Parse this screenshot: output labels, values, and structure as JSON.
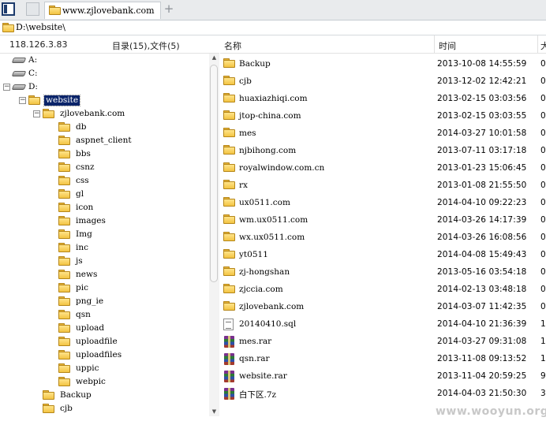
{
  "tab": {
    "title": "www.zjlovebank.com",
    "add": "+"
  },
  "address": {
    "path": "D:\\website\\"
  },
  "left": {
    "ip": "118.126.3.83",
    "counts": "目录(15),文件(5)"
  },
  "tree": [
    {
      "label": "A:",
      "type": "drive",
      "depth": 0,
      "expander": ""
    },
    {
      "label": "C:",
      "type": "drive",
      "depth": 0,
      "expander": ""
    },
    {
      "label": "D:",
      "type": "drive",
      "depth": 0,
      "expander": "−"
    },
    {
      "label": "website",
      "type": "folder",
      "depth": 1,
      "expander": "−",
      "selected": true
    },
    {
      "label": "zjlovebank.com",
      "type": "folder",
      "depth": 2,
      "expander": "−"
    },
    {
      "label": "db",
      "type": "folder",
      "depth": 3,
      "expander": ""
    },
    {
      "label": "aspnet_client",
      "type": "folder",
      "depth": 3,
      "expander": ""
    },
    {
      "label": "bbs",
      "type": "folder",
      "depth": 3,
      "expander": ""
    },
    {
      "label": "csnz",
      "type": "folder",
      "depth": 3,
      "expander": ""
    },
    {
      "label": "css",
      "type": "folder",
      "depth": 3,
      "expander": ""
    },
    {
      "label": "gl",
      "type": "folder",
      "depth": 3,
      "expander": ""
    },
    {
      "label": "icon",
      "type": "folder",
      "depth": 3,
      "expander": ""
    },
    {
      "label": "images",
      "type": "folder",
      "depth": 3,
      "expander": ""
    },
    {
      "label": "Img",
      "type": "folder",
      "depth": 3,
      "expander": ""
    },
    {
      "label": "inc",
      "type": "folder",
      "depth": 3,
      "expander": ""
    },
    {
      "label": "js",
      "type": "folder",
      "depth": 3,
      "expander": ""
    },
    {
      "label": "news",
      "type": "folder",
      "depth": 3,
      "expander": ""
    },
    {
      "label": "pic",
      "type": "folder",
      "depth": 3,
      "expander": ""
    },
    {
      "label": "png_ie",
      "type": "folder",
      "depth": 3,
      "expander": ""
    },
    {
      "label": "qsn",
      "type": "folder",
      "depth": 3,
      "expander": ""
    },
    {
      "label": "upload",
      "type": "folder",
      "depth": 3,
      "expander": ""
    },
    {
      "label": "uploadfile",
      "type": "folder",
      "depth": 3,
      "expander": ""
    },
    {
      "label": "uploadfiles",
      "type": "folder",
      "depth": 3,
      "expander": ""
    },
    {
      "label": "uppic",
      "type": "folder",
      "depth": 3,
      "expander": ""
    },
    {
      "label": "webpic",
      "type": "folder",
      "depth": 3,
      "expander": ""
    },
    {
      "label": "Backup",
      "type": "folder",
      "depth": 2,
      "expander": ""
    },
    {
      "label": "cjb",
      "type": "folder",
      "depth": 2,
      "expander": ""
    }
  ],
  "columns": {
    "name": "名称",
    "time": "时间",
    "size": "大"
  },
  "files": [
    {
      "name": "Backup",
      "time": "2013-10-08 14:55:59",
      "size": "0",
      "type": "folder"
    },
    {
      "name": "cjb",
      "time": "2013-12-02 12:42:21",
      "size": "0",
      "type": "folder"
    },
    {
      "name": "huaxiazhiqi.com",
      "time": "2013-02-15 03:03:56",
      "size": "0",
      "type": "folder"
    },
    {
      "name": "jtop-china.com",
      "time": "2013-02-15 03:03:55",
      "size": "0",
      "type": "folder"
    },
    {
      "name": "mes",
      "time": "2014-03-27 10:01:58",
      "size": "0",
      "type": "folder"
    },
    {
      "name": "njbihong.com",
      "time": "2013-07-11 03:17:18",
      "size": "0",
      "type": "folder"
    },
    {
      "name": "royalwindow.com.cn",
      "time": "2013-01-23 15:06:45",
      "size": "0",
      "type": "folder"
    },
    {
      "name": "rx",
      "time": "2013-01-08 21:55:50",
      "size": "0",
      "type": "folder"
    },
    {
      "name": "ux0511.com",
      "time": "2014-04-10 09:22:23",
      "size": "0",
      "type": "folder"
    },
    {
      "name": "wm.ux0511.com",
      "time": "2014-03-26 14:17:39",
      "size": "0",
      "type": "folder"
    },
    {
      "name": "wx.ux0511.com",
      "time": "2014-03-26 16:08:56",
      "size": "0",
      "type": "folder"
    },
    {
      "name": "yt0511",
      "time": "2014-04-08 15:49:43",
      "size": "0",
      "type": "folder"
    },
    {
      "name": "zj-hongshan",
      "time": "2013-05-16 03:54:18",
      "size": "0",
      "type": "folder"
    },
    {
      "name": "zjccia.com",
      "time": "2014-02-13 03:48:18",
      "size": "0",
      "type": "folder"
    },
    {
      "name": "zjlovebank.com",
      "time": "2014-03-07 11:42:35",
      "size": "0",
      "type": "folder"
    },
    {
      "name": "20140410.sql",
      "time": "2014-04-10 21:36:39",
      "size": "1(",
      "type": "sql"
    },
    {
      "name": "mes.rar",
      "time": "2014-03-27 09:31:08",
      "size": "1'",
      "type": "rar"
    },
    {
      "name": "qsn.rar",
      "time": "2013-11-08 09:13:52",
      "size": "1(",
      "type": "rar"
    },
    {
      "name": "website.rar",
      "time": "2013-11-04 20:59:25",
      "size": "9:",
      "type": "rar"
    },
    {
      "name": "白下区.7z",
      "time": "2014-04-03 21:50:30",
      "size": "3:",
      "type": "rar"
    }
  ],
  "watermark": "www.wooyun.org",
  "icons": {
    "folder": "folder-icon",
    "drive": "drive-icon",
    "rar": "rar-archive-icon",
    "sql": "sql-file-icon",
    "panel_toggle": "panel-toggle-icon",
    "scroll_up": "scroll-up-arrow-icon",
    "scroll_down": "scroll-down-arrow-icon"
  },
  "colors": {
    "selection": "#0a246a",
    "folder": "#f3c443",
    "tabbar": "#e9ebed"
  }
}
